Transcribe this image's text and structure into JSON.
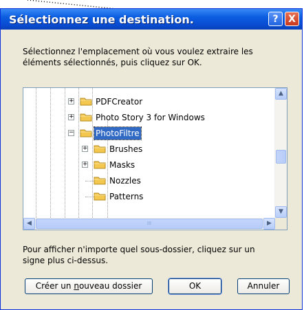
{
  "dialog": {
    "title": "Sélectionnez une destination.",
    "help_label": "?",
    "close_label": "X",
    "instruction_line1": "Sélectionnez l'emplacement où vous voulez extraire les",
    "instruction_line2": "éléments sélectionnés, puis cliquez sur OK.",
    "hint_line1": "Pour afficher n'importe quel sous-dossier, cliquez sur un",
    "hint_line2": "signe plus ci-dessus."
  },
  "tree": {
    "items": [
      {
        "label": "PDFCreator",
        "expander": "+"
      },
      {
        "label": "Photo Story 3 for Windows",
        "expander": "+"
      },
      {
        "label": "PhotoFiltre",
        "expander": "−",
        "selected": true
      },
      {
        "label": "Brushes",
        "expander": "+"
      },
      {
        "label": "Masks",
        "expander": "+"
      },
      {
        "label": "Nozzles",
        "expander": ""
      },
      {
        "label": "Patterns",
        "expander": ""
      }
    ],
    "scroll_up": "▲",
    "scroll_down": "▼",
    "scroll_left": "◀",
    "scroll_right": "▶",
    "thumb_grip": "III"
  },
  "buttons": {
    "new_folder_pre": "Créer un ",
    "new_folder_mnemonic": "n",
    "new_folder_post": "ouveau dossier",
    "ok": "OK",
    "cancel": "Annuler"
  },
  "colors": {
    "titlebar": "#0b5de0",
    "selection": "#316ac5",
    "folder": "#f4c74e"
  }
}
